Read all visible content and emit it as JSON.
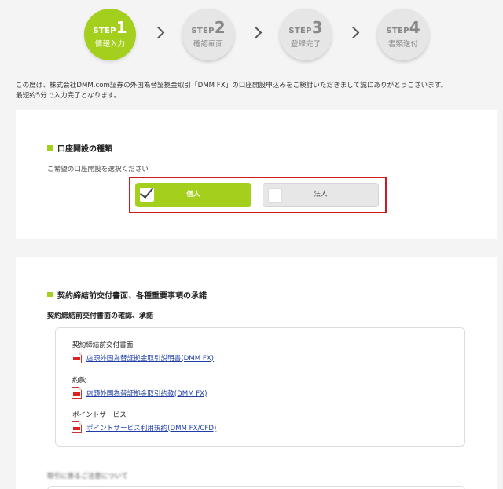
{
  "steps": [
    {
      "word": "STEP",
      "num": "1",
      "label": "情報入力",
      "active": true
    },
    {
      "word": "STEP",
      "num": "2",
      "label": "確認画面",
      "active": false
    },
    {
      "word": "STEP",
      "num": "3",
      "label": "登録完了",
      "active": false
    },
    {
      "word": "STEP",
      "num": "4",
      "label": "書類送付",
      "active": false
    }
  ],
  "intro": {
    "line1": "この度は、株式会社DMM.com証券の外国為替証拠金取引「DMM FX」の口座開設申込みをご検討いただきまして誠にありがとうございます。",
    "line2": "最短約5分で入力完了となります。"
  },
  "account_type": {
    "title": "口座開設の種類",
    "prompt": "ご希望の口座開設を選択ください",
    "options": [
      {
        "label": "個人",
        "selected": true
      },
      {
        "label": "法人",
        "selected": false
      }
    ]
  },
  "contract": {
    "title": "契約締結前交付書面、各種重要事項の承諾",
    "subhead": "契約締結前交付書面の確認、承諾",
    "docs": [
      {
        "label": "契約締結前交付書面",
        "link": "店頭外国為替証拠金取引説明書(DMM FX)"
      },
      {
        "label": "約款",
        "link": "店頭外国為替証拠金取引約款(DMM FX)"
      },
      {
        "label": "ポイントサービス",
        "link": "ポイントサービス利用規約(DMM FX/CFD)"
      }
    ],
    "blurred_heading": "取引に係るご注意について"
  },
  "colors": {
    "accent": "#a5cf1d",
    "highlight_border": "#d21a1a",
    "link": "#1f3ea8"
  },
  "icons": {
    "chevron": "chevron-right-icon",
    "pdf": "pdf-icon",
    "check": "checkmark-icon"
  }
}
